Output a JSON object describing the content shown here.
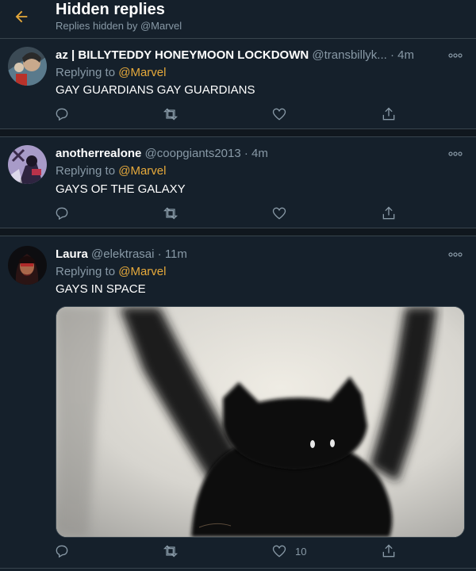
{
  "header": {
    "title": "Hidden replies",
    "subtitle": "Replies hidden by @Marvel",
    "back_icon": "arrow-left-icon"
  },
  "colors": {
    "background": "#15202b",
    "accent": "#e6a93b",
    "secondary_text": "#8899a6",
    "divider": "#38444d"
  },
  "tweets": [
    {
      "name": "az | BILLYTEDDY HONEYMOON LOCKDOWN",
      "handle": "@transbillyk...",
      "dot": "·",
      "time": "4m",
      "reply_prefix": "Replying to ",
      "reply_mention": "@Marvel",
      "text": "GAY GUARDIANS GAY GUARDIANS",
      "like_count": ""
    },
    {
      "name": "anotherrealone",
      "handle": "@coopgiants2013",
      "dot": "·",
      "time": "4m",
      "reply_prefix": "Replying to ",
      "reply_mention": "@Marvel",
      "text": "GAYS OF THE GALAXY",
      "like_count": ""
    },
    {
      "name": "Laura",
      "handle": "@elektrasai",
      "dot": "·",
      "time": "11m",
      "reply_prefix": "Replying to ",
      "reply_mention": "@Marvel",
      "text": "GAYS IN SPACE",
      "like_count": "10",
      "media": "black cat with raised arms photo"
    }
  ]
}
